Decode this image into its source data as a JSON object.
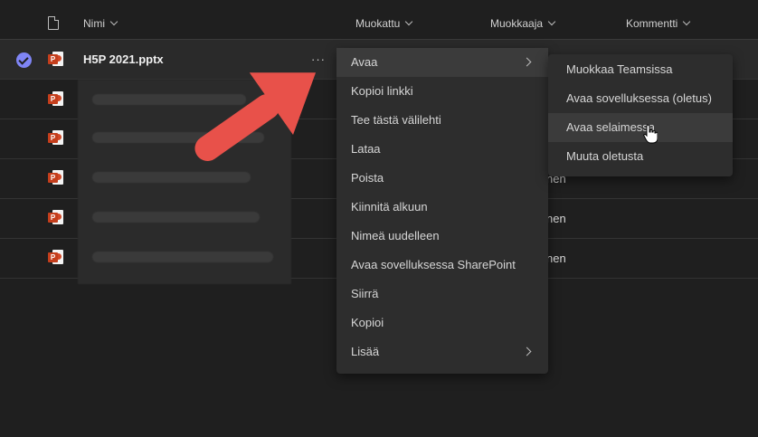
{
  "header": {
    "name_label": "Nimi",
    "modified_label": "Muokattu",
    "modified_by_label": "Muokkaaja",
    "comment_label": "Kommentti"
  },
  "file": {
    "name": "H5P 2021.pptx",
    "more_label": "···",
    "type_badge": "P"
  },
  "partial_text": [
    "nen",
    "nen",
    "nen"
  ],
  "menu": {
    "items": [
      {
        "label": "Avaa",
        "has_submenu": true
      },
      {
        "label": "Kopioi linkki"
      },
      {
        "label": "Tee tästä välilehti"
      },
      {
        "label": "Lataa"
      },
      {
        "label": "Poista"
      },
      {
        "label": "Kiinnitä alkuun"
      },
      {
        "label": "Nimeä uudelleen"
      },
      {
        "label": "Avaa sovelluksessa SharePoint"
      },
      {
        "label": "Siirrä"
      },
      {
        "label": "Kopioi"
      },
      {
        "label": "Lisää",
        "has_submenu": true
      }
    ]
  },
  "submenu": {
    "items": [
      {
        "label": "Muokkaa Teamsissa"
      },
      {
        "label": "Avaa sovelluksessa (oletus)"
      },
      {
        "label": "Avaa selaimessa"
      },
      {
        "label": "Muuta oletusta"
      }
    ]
  },
  "colors": {
    "background": "#1f1f1f",
    "menu_bg": "#2d2d2d",
    "accent_check": "#7f85f5",
    "ppt_red": "#c43e1c",
    "callout_arrow": "#e8514a"
  }
}
